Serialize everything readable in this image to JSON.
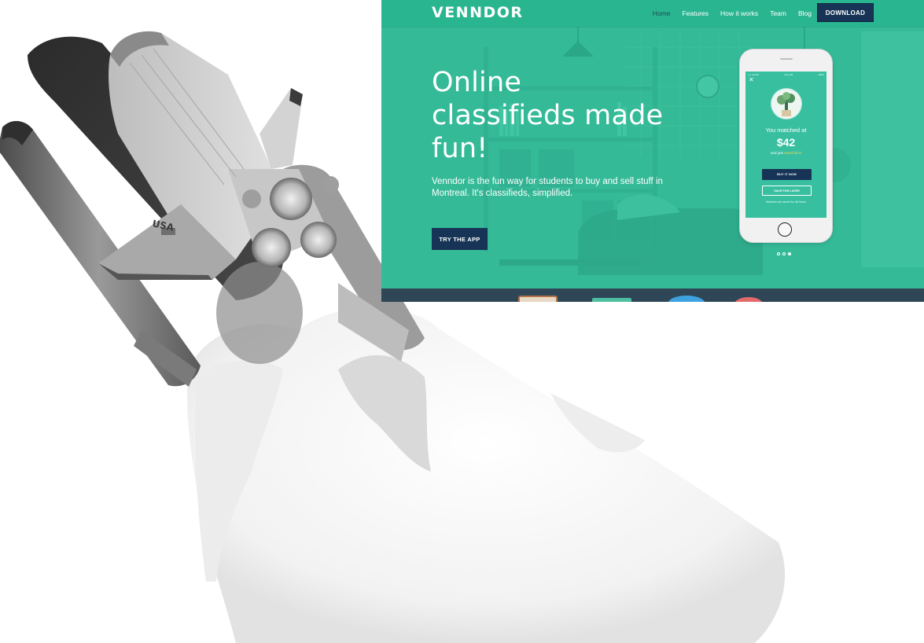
{
  "site": {
    "brand": {
      "name": "VENNDOR",
      "accent_color": "#2fb894",
      "navy_color": "#173456"
    },
    "nav": {
      "links": [
        {
          "label": "Home",
          "active": true
        },
        {
          "label": "Features"
        },
        {
          "label": "How it works"
        },
        {
          "label": "Team"
        },
        {
          "label": "Blog"
        }
      ],
      "download_label": "DOWNLOAD"
    },
    "hero": {
      "title_line1": "Online",
      "title_line2": "classifieds made",
      "title_line3": "fun!",
      "body_line1": "Venndor is the fun way for students to buy and sell stuff in",
      "body_line2": "Montreal. It's classifieds, simplified.",
      "cta_label": "TRY THE APP"
    },
    "phone": {
      "status_left": "•••• Carrier",
      "status_time": "9:41 AM",
      "status_right": "100%",
      "match_label": "You matched at",
      "match_price": "$42",
      "saved_prefix": "and just",
      "saved_amount": "saved $13!",
      "buy_label": "BUY IT NOW",
      "save_label": "SAVE FOR LATER",
      "note": "Matches are saved for 48 hours"
    },
    "carousel": {
      "slide_count": 3,
      "active_index": 2
    }
  },
  "decor": {
    "shuttle_flag_text": "USA"
  }
}
